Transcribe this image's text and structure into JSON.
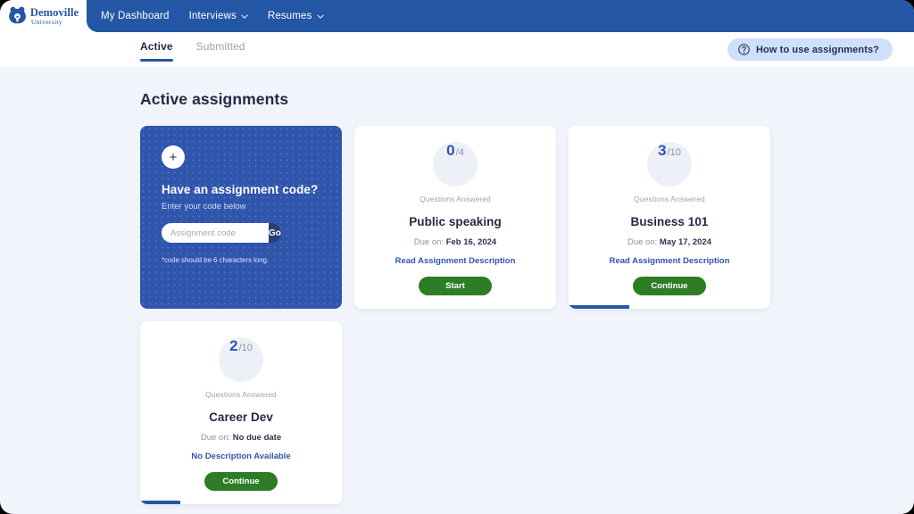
{
  "navbar": {
    "logo": {
      "icon": "bear-mascot-icon",
      "name": "Demoville",
      "sub": "University"
    },
    "links": [
      {
        "label": "My Dashboard",
        "has_chevron": false
      },
      {
        "label": "Interviews",
        "has_chevron": true
      },
      {
        "label": "Resumes",
        "has_chevron": true
      }
    ]
  },
  "subheader": {
    "tabs": [
      {
        "label": "Active",
        "active": true
      },
      {
        "label": "Submitted",
        "active": false
      }
    ],
    "help": {
      "icon": "question-circle-icon",
      "label": "How to use assignments?"
    }
  },
  "main": {
    "title": "Active assignments",
    "promo": {
      "plus_icon": "plus-icon",
      "title": "Have an assignment code?",
      "subtitle": "Enter your code below",
      "input_value": "",
      "input_placeholder": "Assignment code",
      "go_label": "Go",
      "note": "*code should be 6 characters long."
    },
    "cards": [
      {
        "answered": "0",
        "total": "/4",
        "score_label": "Questions Answered",
        "title": "Public speaking",
        "due_prefix": "Due on: ",
        "due_value": "Feb 16, 2024",
        "link": "Read Assignment Description",
        "button": "Start",
        "progress_percent": 0
      },
      {
        "answered": "3",
        "total": "/10",
        "score_label": "Questions Answered",
        "title": "Business 101",
        "due_prefix": "Due on: ",
        "due_value": "May 17, 2024",
        "link": "Read Assignment Description",
        "button": "Continue",
        "progress_percent": 30
      },
      {
        "answered": "2",
        "total": "/10",
        "score_label": "Questions Answered",
        "title": "Career Dev",
        "due_prefix": "Due on: ",
        "due_value": "No due date",
        "link": "No Description Available",
        "button": "Continue",
        "progress_percent": 20
      }
    ]
  },
  "colors": {
    "navbar_blue": "#2456a6",
    "promo_blue": "#2f55ad",
    "accent_blue": "#2f55ad",
    "green": "#2d7d26",
    "page_bg": "#f1f4fb",
    "help_pill": "#cfe0fb"
  }
}
